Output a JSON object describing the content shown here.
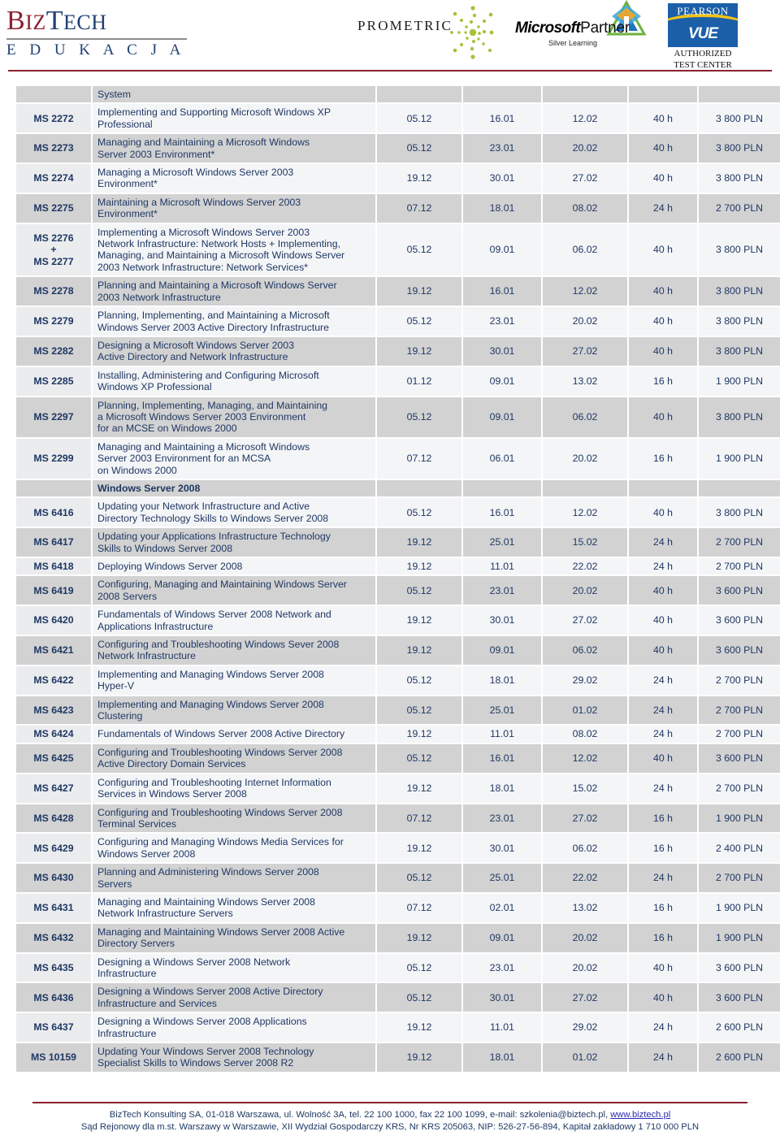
{
  "header": {
    "biztech": {
      "line1_part1": "B",
      "line1_part1b": "IZ",
      "line1_part2": "T",
      "line1_part2b": "ECH",
      "line2": "E D U K A C J A",
      "alt_text": "BizTech Edukacja"
    },
    "prometric": {
      "label": "PROMETRIC",
      "icon": "prometric-burst-icon"
    },
    "microsoft_partner": {
      "brand": "Microsoft",
      "partner": "Partner",
      "level": "Silver Learning",
      "icon": "microsoft-partner-badge-icon"
    },
    "pearson_vue": {
      "brand": "PEARSON",
      "vue": "VUE",
      "line1": "AUTHORIZED",
      "line2": "TEST CENTER"
    }
  },
  "table": {
    "header_row": {
      "code": "",
      "name": "System",
      "d1": "",
      "d2": "",
      "d3": "",
      "hours": "",
      "price": ""
    },
    "rows": [
      {
        "type": "course",
        "shade": false,
        "code": "MS 2272",
        "name": "Implementing and Supporting Microsoft Windows XP\nProfessional",
        "d1": "05.12",
        "d2": "16.01",
        "d3": "12.02",
        "hours": "40 h",
        "price": "3 800 PLN"
      },
      {
        "type": "course",
        "shade": true,
        "code": "MS 2273",
        "name": "Managing and Maintaining a Microsoft Windows\nServer 2003 Environment*",
        "d1": "05.12",
        "d2": "23.01",
        "d3": "20.02",
        "hours": "40 h",
        "price": "3 800 PLN"
      },
      {
        "type": "course",
        "shade": false,
        "code": "MS 2274",
        "name": "Managing a Microsoft Windows Server 2003\nEnvironment*",
        "d1": "19.12",
        "d2": "30.01",
        "d3": "27.02",
        "hours": "40 h",
        "price": "3 800 PLN"
      },
      {
        "type": "course",
        "shade": true,
        "code": "MS 2275",
        "name": "Maintaining a Microsoft Windows Server 2003\nEnvironment*",
        "d1": "07.12",
        "d2": "18.01",
        "d3": "08.02",
        "hours": "24 h",
        "price": "2 700 PLN"
      },
      {
        "type": "course",
        "shade": false,
        "code": "MS 2276\n+\nMS 2277",
        "name": "Implementing a Microsoft Windows Server 2003\nNetwork Infrastructure: Network Hosts + Implementing,\nManaging, and Maintaining a Microsoft Windows Server\n2003 Network Infrastructure: Network Services*",
        "d1": "05.12",
        "d2": "09.01",
        "d3": "06.02",
        "hours": "40 h",
        "price": "3 800 PLN"
      },
      {
        "type": "course",
        "shade": true,
        "code": "MS 2278",
        "name": "Planning and Maintaining a Microsoft Windows Server\n2003 Network Infrastructure",
        "d1": "19.12",
        "d2": "16.01",
        "d3": "12.02",
        "hours": "40 h",
        "price": "3 800 PLN"
      },
      {
        "type": "course",
        "shade": false,
        "code": "MS 2279",
        "name": "Planning, Implementing, and Maintaining a Microsoft\nWindows Server 2003 Active Directory Infrastructure",
        "d1": "05.12",
        "d2": "23.01",
        "d3": "20.02",
        "hours": "40 h",
        "price": "3 800 PLN"
      },
      {
        "type": "course",
        "shade": true,
        "code": "MS 2282",
        "name": "Designing a Microsoft Windows Server 2003\nActive Directory and Network Infrastructure",
        "d1": "19.12",
        "d2": "30.01",
        "d3": "27.02",
        "hours": "40 h",
        "price": "3 800 PLN"
      },
      {
        "type": "course",
        "shade": false,
        "code": "MS 2285",
        "name": "Installing, Administering and Configuring Microsoft\nWindows XP Professional",
        "d1": "01.12",
        "d2": "09.01",
        "d3": "13.02",
        "hours": "16 h",
        "price": "1 900 PLN"
      },
      {
        "type": "course",
        "shade": true,
        "code": "MS 2297",
        "name": "Planning, Implementing, Managing, and Maintaining\na Microsoft Windows Server 2003 Environment\nfor an MCSE on Windows 2000",
        "d1": "05.12",
        "d2": "09.01",
        "d3": "06.02",
        "hours": "40 h",
        "price": "3 800 PLN"
      },
      {
        "type": "course",
        "shade": false,
        "code": "MS 2299",
        "name": "Managing and Maintaining a Microsoft Windows\nServer 2003 Environment for an MCSA\non Windows 2000",
        "d1": "07.12",
        "d2": "06.01",
        "d3": "20.02",
        "hours": "16 h",
        "price": "1 900 PLN"
      },
      {
        "type": "section",
        "title": "Windows Server 2008"
      },
      {
        "type": "course",
        "shade": false,
        "code": "MS 6416",
        "name": "Updating your Network Infrastructure and Active\nDirectory Technology Skills to Windows Server 2008",
        "d1": "05.12",
        "d2": "16.01",
        "d3": "12.02",
        "hours": "40 h",
        "price": "3 800 PLN"
      },
      {
        "type": "course",
        "shade": true,
        "code": "MS 6417",
        "name": "Updating your Applications Infrastructure Technology\nSkills to Windows Server 2008",
        "d1": "19.12",
        "d2": "25.01",
        "d3": "15.02",
        "hours": "24 h",
        "price": "2 700 PLN"
      },
      {
        "type": "course",
        "shade": false,
        "code": "MS 6418",
        "name": "Deploying Windows Server 2008",
        "d1": "19.12",
        "d2": "11.01",
        "d3": "22.02",
        "hours": "24 h",
        "price": "2 700 PLN"
      },
      {
        "type": "course",
        "shade": true,
        "code": "MS 6419",
        "name": "Configuring, Managing and Maintaining Windows Server\n2008 Servers",
        "d1": "05.12",
        "d2": "23.01",
        "d3": "20.02",
        "hours": "40 h",
        "price": "3 600 PLN"
      },
      {
        "type": "course",
        "shade": false,
        "code": "MS 6420",
        "name": "Fundamentals of Windows Server 2008 Network and\nApplications Infrastructure",
        "d1": "19.12",
        "d2": "30.01",
        "d3": "27.02",
        "hours": "40 h",
        "price": "3 600 PLN"
      },
      {
        "type": "course",
        "shade": true,
        "code": "MS 6421",
        "name": "Configuring and Troubleshooting  Windows Sever 2008\nNetwork Infrastructure",
        "d1": "19.12",
        "d2": "09.01",
        "d3": "06.02",
        "hours": "40 h",
        "price": "3 600 PLN"
      },
      {
        "type": "course",
        "shade": false,
        "code": "MS 6422",
        "name": "Implementing and Managing Windows Server 2008\nHyper-V",
        "d1": "05.12",
        "d2": "18.01",
        "d3": "29.02",
        "hours": "24 h",
        "price": "2 700 PLN"
      },
      {
        "type": "course",
        "shade": true,
        "code": "MS 6423",
        "name": "Implementing and Managing Windows Server 2008\nClustering",
        "d1": "05.12",
        "d2": "25.01",
        "d3": "01.02",
        "hours": "24 h",
        "price": "2 700 PLN"
      },
      {
        "type": "course",
        "shade": false,
        "code": "MS 6424",
        "name": "Fundamentals of Windows Server 2008 Active Directory",
        "d1": "19.12",
        "d2": "11.01",
        "d3": "08.02",
        "hours": "24 h",
        "price": "2 700 PLN"
      },
      {
        "type": "course",
        "shade": true,
        "code": "MS 6425",
        "name": "Configuring and Troubleshooting Windows Server 2008\nActive Directory Domain Services",
        "d1": "05.12",
        "d2": "16.01",
        "d3": "12.02",
        "hours": "40 h",
        "price": "3 600 PLN"
      },
      {
        "type": "course",
        "shade": false,
        "code": "MS 6427",
        "name": "Configuring and Troubleshooting Internet Information\nServices in Windows Server 2008",
        "d1": "19.12",
        "d2": "18.01",
        "d3": "15.02",
        "hours": "24 h",
        "price": "2 700 PLN"
      },
      {
        "type": "course",
        "shade": true,
        "code": "MS 6428",
        "name": "Configuring and Troubleshooting Windows Server 2008\nTerminal Services",
        "d1": "07.12",
        "d2": "23.01",
        "d3": "27.02",
        "hours": "16 h",
        "price": "1 900 PLN"
      },
      {
        "type": "course",
        "shade": false,
        "code": "MS 6429",
        "name": "Configuring and Managing Windows Media Services for\nWindows Server 2008",
        "d1": "19.12",
        "d2": "30.01",
        "d3": "06.02",
        "hours": "16 h",
        "price": "2 400 PLN"
      },
      {
        "type": "course",
        "shade": true,
        "code": "MS 6430",
        "name": "Planning and Administering Windows Server 2008\nServers",
        "d1": "05.12",
        "d2": "25.01",
        "d3": "22.02",
        "hours": "24 h",
        "price": "2 700 PLN"
      },
      {
        "type": "course",
        "shade": false,
        "code": "MS 6431",
        "name": "Managing and Maintaining Windows Server 2008\nNetwork Infrastructure Servers",
        "d1": "07.12",
        "d2": "02.01",
        "d3": "13.02",
        "hours": "16 h",
        "price": "1 900 PLN"
      },
      {
        "type": "course",
        "shade": true,
        "code": "MS 6432",
        "name": "Managing and Maintaining Windows Server 2008 Active\nDirectory Servers",
        "d1": "19.12",
        "d2": "09.01",
        "d3": "20.02",
        "hours": "16 h",
        "price": "1 900 PLN"
      },
      {
        "type": "course",
        "shade": false,
        "code": "MS 6435",
        "name": "Designing a Windows Server 2008 Network\nInfrastructure",
        "d1": "05.12",
        "d2": "23.01",
        "d3": "20.02",
        "hours": "40 h",
        "price": "3 600 PLN"
      },
      {
        "type": "course",
        "shade": true,
        "code": "MS 6436",
        "name": "Designing a Windows Server 2008 Active Directory\nInfrastructure and Services",
        "d1": "05.12",
        "d2": "30.01",
        "d3": "27.02",
        "hours": "40 h",
        "price": "3 600 PLN"
      },
      {
        "type": "course",
        "shade": false,
        "code": "MS 6437",
        "name": "Designing a Windows Server 2008 Applications\nInfrastructure",
        "d1": "19.12",
        "d2": "11.01",
        "d3": "29.02",
        "hours": "24 h",
        "price": "2 600 PLN"
      },
      {
        "type": "course",
        "shade": true,
        "code": "MS 10159",
        "name": "Updating Your Windows Server 2008 Technology\nSpecialist Skills to Windows Server 2008 R2",
        "d1": "19.12",
        "d2": "18.01",
        "d3": "01.02",
        "hours": "24 h",
        "price": "2 600 PLN"
      }
    ]
  },
  "footer": {
    "line1_pre": "BizTech Konsulting SA, 01-018 Warszawa, ul. Wolność 3A, tel. 22 100 1000, fax 22 100 1099, e-mail: szkolenia@biztech.pl, ",
    "line1_link": "www.biztech.pl",
    "line2": "Sąd Rejonowy dla m.st. Warszawy w Warszawie, XII Wydział Gospodarczy KRS, Nr KRS 205063, NIP: 526-27-56-894, Kapitał zakładowy 1 710 000 PLN"
  },
  "colors": {
    "accent_red": "#8c2130",
    "navy": "#1f3864",
    "row_shade": "#d2d2d2",
    "row_plain": "#f4f5f7",
    "pearson_blue": "#1b5fa8"
  }
}
